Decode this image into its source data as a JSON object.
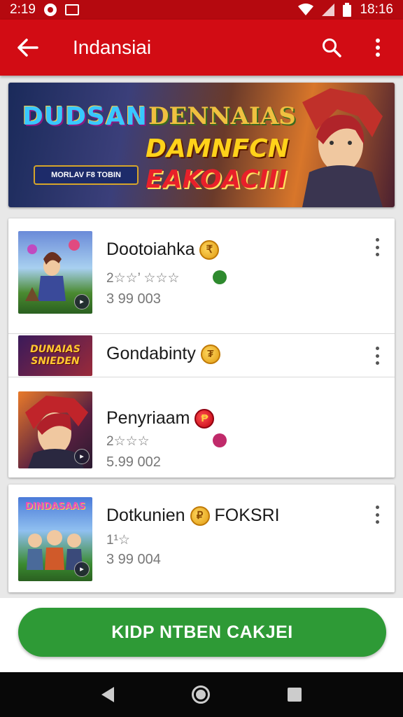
{
  "status_bar": {
    "time": "2:19",
    "clock": "18:16"
  },
  "app_bar": {
    "title": "Indansiai"
  },
  "banner": {
    "logo_left": "DUDSAN",
    "sub_left": "MORLAV F8 TOBIN",
    "title_top": "DENNAIAS",
    "title_mid": "DAMNFCN",
    "title_bot": "EAKOACIII"
  },
  "apps": [
    {
      "name": "Dootoiahka",
      "rating": "2☆☆’  ☆☆☆",
      "downloads": "3 99 003",
      "coin": "₹"
    },
    {
      "name": "Gondabinty",
      "banner_text": "DUNAIAS SNIEDEN",
      "coin": "₮"
    },
    {
      "name": "Penyriaam",
      "rating": "2☆☆☆",
      "downloads": "5.99 002",
      "coin": "₱"
    },
    {
      "name": "Dotkunien",
      "extra": "FOKSRI",
      "rating": "1¹☆",
      "downloads": "3 99 004",
      "coin": "₽",
      "thumb_text": "DINDASAAS"
    }
  ],
  "install_button": "KIDP NTBEN CAKJEI",
  "colors": {
    "primary": "#d20c14",
    "status": "#b5090f",
    "install": "#2e9a36"
  }
}
